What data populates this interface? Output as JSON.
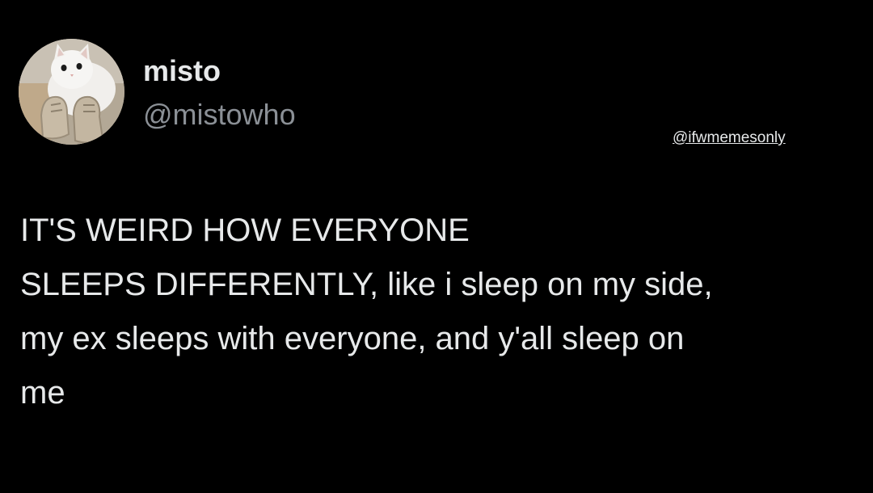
{
  "post": {
    "author": {
      "display_name": "misto",
      "handle": "@mistowho",
      "avatar_icon": "cat-avatar"
    },
    "watermark": "@ifwmemesonly",
    "text_lines": [
      "IT'S WEIRD HOW EVERYONE",
      "SLEEPS DIFFERENTLY, like i sleep on my side,",
      "my ex sleeps with everyone, and y'all sleep on",
      "me"
    ]
  },
  "colors": {
    "background": "#000000",
    "primary_text": "#e7e9ea",
    "secondary_text": "#8b9096"
  }
}
